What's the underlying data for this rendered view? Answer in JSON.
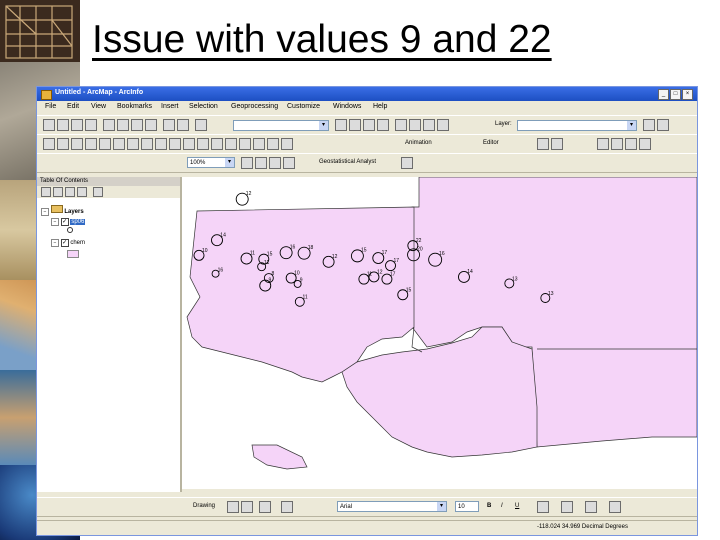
{
  "slide": {
    "title": "Issue with values 9 and 22"
  },
  "window": {
    "title": "Untitled - ArcMap - ArcInfo",
    "controls": [
      "_",
      "□",
      "×"
    ]
  },
  "menu": [
    "File",
    "Edit",
    "View",
    "Bookmarks",
    "Insert",
    "Selection",
    "Geoprocessing",
    "Customize",
    "Windows",
    "Help"
  ],
  "toolbar": {
    "layer_label": "Layer:",
    "scale_value": "100%",
    "geostat_label": "Geostatistical Analyst",
    "animation_label": "Animation",
    "editor_label": "Editor",
    "drawing_label": "Drawing",
    "font_name": "Arial",
    "font_size": "10",
    "bold": "B",
    "italic": "I",
    "underline": "U"
  },
  "toc": {
    "title": "Table Of Contents",
    "root": "Layers",
    "layers": [
      {
        "name": "sp06",
        "checked": true,
        "selected": true
      },
      {
        "name": "chem",
        "checked": true,
        "selected": false
      }
    ]
  },
  "map": {
    "fill_color": "#f5d4f8",
    "points": [
      {
        "label": "12",
        "x": 33.5,
        "y": 36.7,
        "r": 1.2
      },
      {
        "label": "11",
        "x": 21.1,
        "y": 40.6,
        "r": 1.4
      },
      {
        "label": "13",
        "x": 21.1,
        "y": 44.9,
        "r": 1.2
      },
      {
        "label": "14",
        "x": 30.0,
        "y": 44.3,
        "r": 1.1
      },
      {
        "label": "10",
        "x": 27.5,
        "y": 47.1,
        "r": 1.0
      },
      {
        "label": "11",
        "x": 34.1,
        "y": 47.7,
        "r": 1.1
      },
      {
        "label": "15",
        "x": 36.5,
        "y": 47.8,
        "r": 1.0
      },
      {
        "label": "16",
        "x": 39.6,
        "y": 46.6,
        "r": 1.2
      },
      {
        "label": "18",
        "x": 42.1,
        "y": 46.7,
        "r": 1.2
      },
      {
        "label": "11",
        "x": 36.2,
        "y": 49.2,
        "r": 0.8
      },
      {
        "label": "12",
        "x": 45.5,
        "y": 48.3,
        "r": 1.1
      },
      {
        "label": "15",
        "x": 49.5,
        "y": 47.2,
        "r": 1.2
      },
      {
        "label": "17",
        "x": 52.4,
        "y": 47.6,
        "r": 1.1
      },
      {
        "label": "22",
        "x": 57.2,
        "y": 45.3,
        "r": 1.0
      },
      {
        "label": "20",
        "x": 57.3,
        "y": 47.0,
        "r": 1.2
      },
      {
        "label": "16",
        "x": 60.3,
        "y": 47.9,
        "r": 1.3
      },
      {
        "label": "17",
        "x": 54.1,
        "y": 49.0,
        "r": 1.0
      },
      {
        "label": "10",
        "x": 40.3,
        "y": 51.3,
        "r": 1.0
      },
      {
        "label": "8",
        "x": 37.2,
        "y": 51.3,
        "r": 0.9
      },
      {
        "label": "16",
        "x": 29.8,
        "y": 50.5,
        "r": 0.7
      },
      {
        "label": "9",
        "x": 36.7,
        "y": 52.7,
        "r": 1.1
      },
      {
        "label": "9",
        "x": 41.2,
        "y": 52.4,
        "r": 0.7
      },
      {
        "label": "14",
        "x": 64.3,
        "y": 51.1,
        "r": 1.1
      },
      {
        "label": "13",
        "x": 70.6,
        "y": 52.3,
        "r": 0.9
      },
      {
        "label": "11",
        "x": 41.5,
        "y": 55.7,
        "r": 0.9
      },
      {
        "label": "15",
        "x": 55.8,
        "y": 54.4,
        "r": 1.0
      },
      {
        "label": "13",
        "x": 75.6,
        "y": 55.0,
        "r": 0.9
      },
      {
        "label": "11",
        "x": 50.4,
        "y": 51.5,
        "r": 1.0
      },
      {
        "label": "12",
        "x": 51.8,
        "y": 51.1,
        "r": 1.0
      },
      {
        "label": "17",
        "x": 53.6,
        "y": 51.5,
        "r": 1.0
      }
    ]
  },
  "status": {
    "coords": "-118.024 34.969 Decimal Degrees"
  }
}
